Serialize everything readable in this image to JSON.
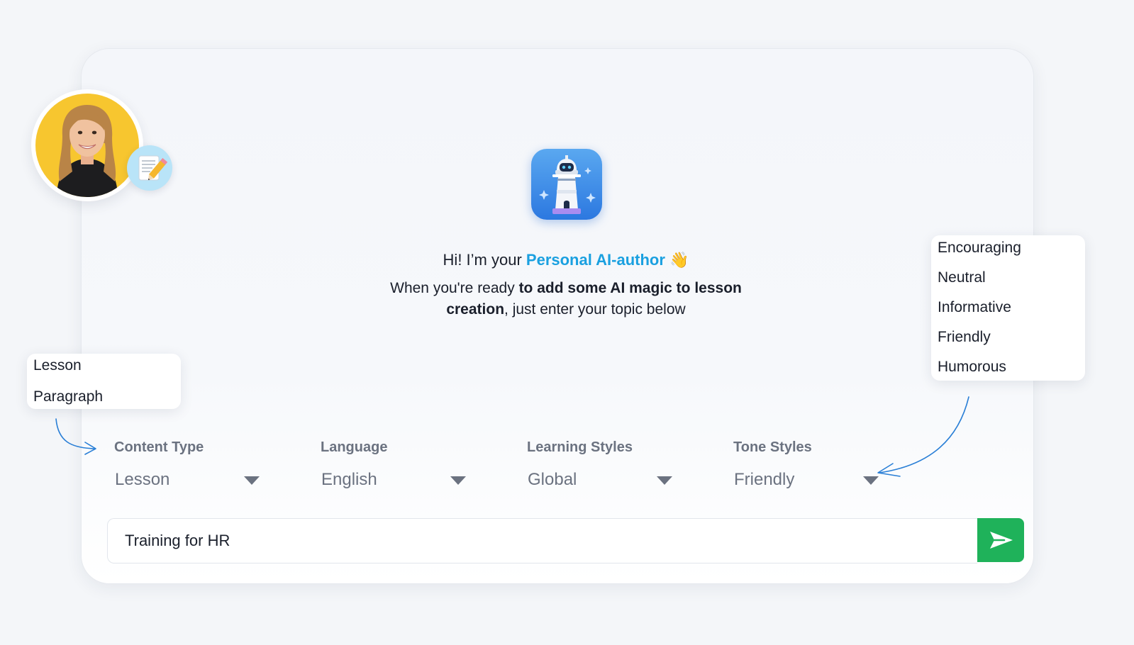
{
  "greeting": {
    "prefix": "Hi! I’m your ",
    "highlight": "Personal AI-author",
    "emoji": "👋"
  },
  "intro": {
    "part1": "When you're ready ",
    "bold": "to add some AI magic to lesson creation",
    "part2": ", just enter your topic below"
  },
  "content_type_options": [
    "Lesson",
    "Paragraph"
  ],
  "tone_options": [
    "Encouraging",
    "Neutral",
    "Informative",
    "Friendly",
    "Humorous"
  ],
  "fields": {
    "content_type": {
      "label": "Content Type",
      "value": "Lesson"
    },
    "language": {
      "label": "Language",
      "value": "English"
    },
    "learning_styles": {
      "label": "Learning Styles",
      "value": "Global"
    },
    "tone_styles": {
      "label": "Tone Styles",
      "value": "Friendly"
    }
  },
  "topic_input": {
    "value": "Training for HR"
  },
  "colors": {
    "accent": "#1aa0e0",
    "send_button": "#1fb25a",
    "avatar_bg": "#f7c62f",
    "arrow": "#2a7fd6"
  },
  "icons": {
    "avatar": "user-avatar",
    "badge": "memo-pencil-icon",
    "logo": "lighthouse-robot-icon",
    "caret": "caret-down-icon",
    "send": "send-icon"
  }
}
